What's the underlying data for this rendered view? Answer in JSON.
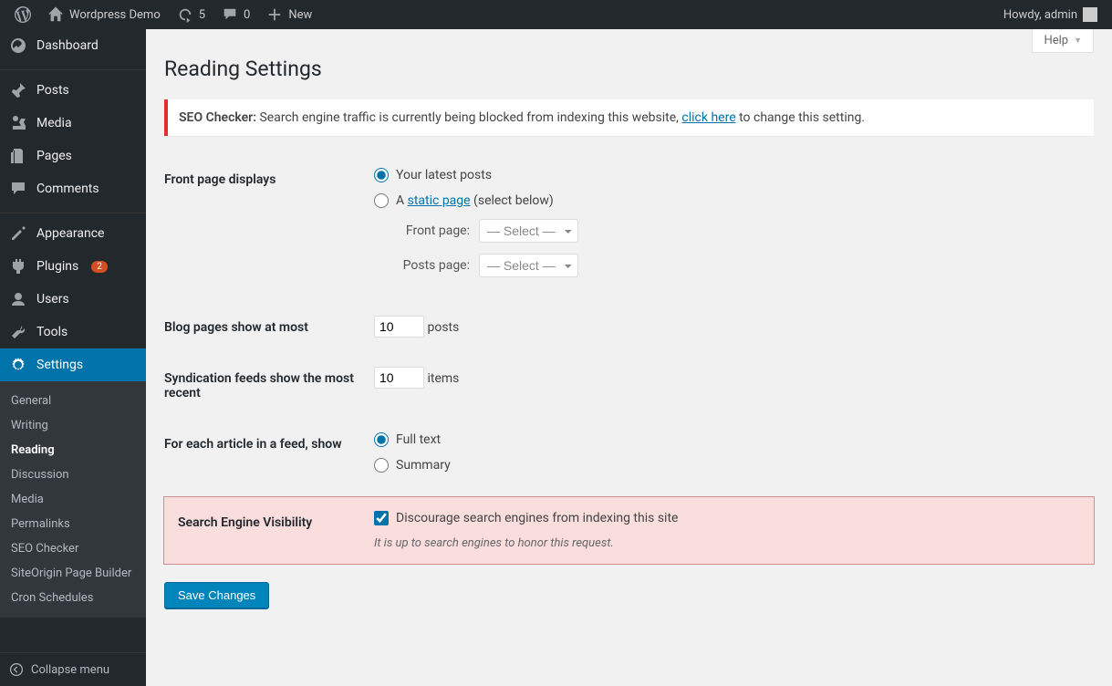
{
  "adminbar": {
    "site_name": "Wordpress Demo",
    "updates_count": "5",
    "comments_count": "0",
    "new_label": "New",
    "howdy": "Howdy, admin"
  },
  "sidebar": {
    "dashboard": "Dashboard",
    "posts": "Posts",
    "media": "Media",
    "pages": "Pages",
    "comments": "Comments",
    "appearance": "Appearance",
    "plugins": "Plugins",
    "plugins_badge": "2",
    "users": "Users",
    "tools": "Tools",
    "settings": "Settings",
    "collapse": "Collapse menu"
  },
  "submenu": {
    "general": "General",
    "writing": "Writing",
    "reading": "Reading",
    "discussion": "Discussion",
    "media": "Media",
    "permalinks": "Permalinks",
    "seo_checker": "SEO Checker",
    "siteorigin": "SiteOrigin Page Builder",
    "cron": "Cron Schedules"
  },
  "page": {
    "help": "Help",
    "title": "Reading Settings"
  },
  "notice": {
    "prefix": "SEO Checker:",
    "text1": " Search engine traffic is currently being blocked from indexing this website, ",
    "link": "click here",
    "text2": " to change this setting."
  },
  "form": {
    "front_page_displays": "Front page displays",
    "latest_posts": "Your latest posts",
    "static_page_a": "A ",
    "static_page_link": "static page",
    "static_page_b": " (select below)",
    "front_page_label": "Front page:",
    "posts_page_label": "Posts page:",
    "select_placeholder": "— Select —",
    "blog_pages_label": "Blog pages show at most",
    "blog_pages_value": "10",
    "blog_pages_suffix": "posts",
    "syndication_label": "Syndication feeds show the most recent",
    "syndication_value": "10",
    "syndication_suffix": "items",
    "feed_article_label": "For each article in a feed, show",
    "full_text": "Full text",
    "summary": "Summary",
    "search_visibility_label": "Search Engine Visibility",
    "discourage": "Discourage search engines from indexing this site",
    "discourage_desc": "It is up to search engines to honor this request.",
    "save": "Save Changes"
  }
}
